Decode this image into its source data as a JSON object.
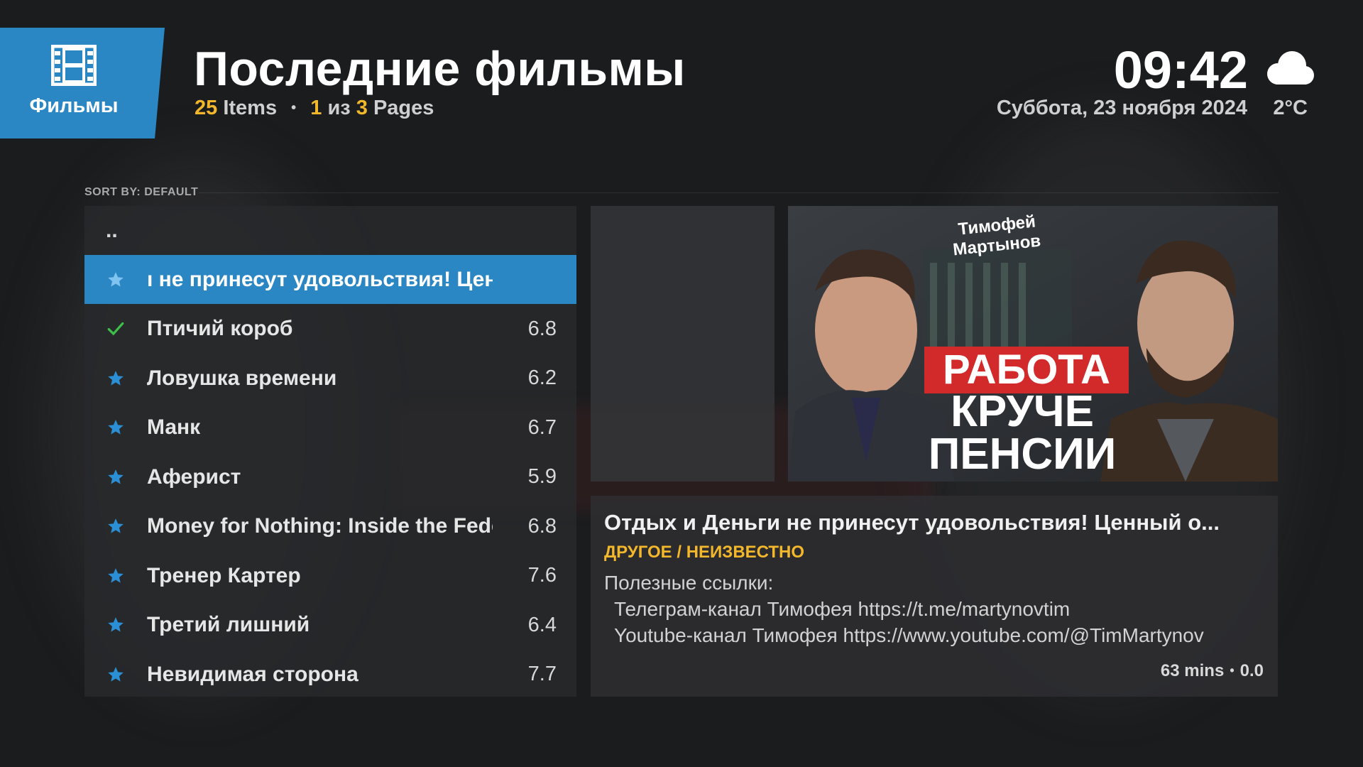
{
  "header": {
    "category_label": "Фильмы",
    "title": "Последние фильмы",
    "items_count": "25",
    "items_word": "Items",
    "page_current": "1",
    "page_of": "из",
    "page_total": "3",
    "pages_word": "Pages",
    "clock": "09:42",
    "date": "Суббота, 23 ноября 2024",
    "temperature": "2°C",
    "weather_icon": "cloud-icon"
  },
  "sort_label": "SORT BY: DEFAULT",
  "list": {
    "parent": "..",
    "items": [
      {
        "title": "ı не принесут удовольствия! Ценный опı",
        "rating": "",
        "icon": "star-icon",
        "selected": true
      },
      {
        "title": "Птичий короб",
        "rating": "6.8",
        "icon": "check-icon"
      },
      {
        "title": "Ловушка времени",
        "rating": "6.2",
        "icon": "star-icon"
      },
      {
        "title": "Манк",
        "rating": "6.7",
        "icon": "star-icon"
      },
      {
        "title": "Аферист",
        "rating": "5.9",
        "icon": "star-icon"
      },
      {
        "title": "Money for Nothing: Inside the Fede...",
        "rating": "6.8",
        "icon": "star-icon"
      },
      {
        "title": "Тренер Картер",
        "rating": "7.6",
        "icon": "star-icon"
      },
      {
        "title": "Третий лишний",
        "rating": "6.4",
        "icon": "star-icon"
      },
      {
        "title": "Невидимая сторона",
        "rating": "7.7",
        "icon": "star-icon"
      }
    ]
  },
  "poster": {
    "name_line1": "Тимофей",
    "name_line2": "Мартынов",
    "headline1": "РАБОТА",
    "headline2": "КРУЧЕ",
    "headline3": "ПЕНСИИ"
  },
  "info": {
    "title": "Отдых и Деньги не принесут удовольствия! Ценный о...",
    "genre": "ДРУГОЕ / НЕИЗВЕСТНО",
    "plot_line1": "Полезные ссылки:",
    "plot_line2": "Телеграм-канал Тимофея https://t.me/martynovtim",
    "plot_line3": "Youtube-канал Тимофея https://www.youtube.com/@TimMartynov",
    "duration": "63 mins",
    "rating": "0.0"
  },
  "colors": {
    "accent": "#2b86c4",
    "highlight": "#f3b72c",
    "star": "#2b8fd6",
    "check": "#3fbf4a"
  }
}
